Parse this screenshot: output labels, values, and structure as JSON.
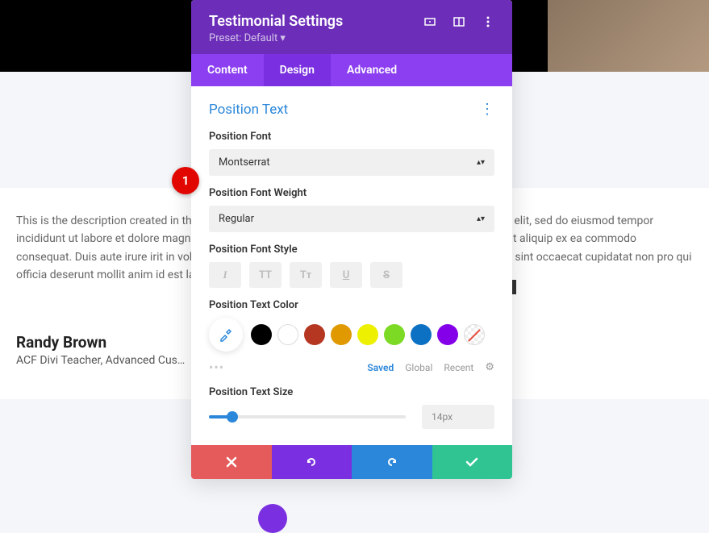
{
  "background": {
    "description": "This is the description created in the ACF form. Lorem ipsum dolor sit amet, consectetur adipiscing elit, sed do eiusmod tempor incididunt ut labore et dolore magna aliqua. Ut enim, quis nostrud exercitation ullamco laboris nisi ut aliquip ex ea commodo consequat. Duis aute irure irit in voluptate velit esse cillum dolore eu fugiat nulla pariatur. Excepteur sint occaecat cupidatat non pro qui officia deserunt mollit anim id est laborum.",
    "author": "Randy Brown",
    "author_title": "ACF Divi Teacher, Advanced Cus…"
  },
  "panel": {
    "title": "Testimonial Settings",
    "preset": "Preset: Default ▾",
    "tabs": {
      "content": "Content",
      "design": "Design",
      "advanced": "Advanced"
    },
    "section": "Position Text",
    "labels": {
      "font": "Position Font",
      "weight": "Position Font Weight",
      "style": "Position Font Style",
      "color": "Position Text Color",
      "size": "Position Text Size"
    },
    "values": {
      "font": "Montserrat",
      "weight": "Regular",
      "size": "14px"
    },
    "style_buttons": {
      "italic": "I",
      "uppercase": "TT",
      "smallcaps": "Tᴛ",
      "underline": "U",
      "strikethrough": "S"
    },
    "colors": {
      "black": "#000000",
      "white": "#ffffff",
      "red": "#b53621",
      "orange": "#e09900",
      "yellow": "#edf000",
      "green": "#7cda24",
      "blue": "#0c71c3",
      "purple": "#8300e9"
    },
    "color_tabs": {
      "saved": "Saved",
      "global": "Global",
      "recent": "Recent"
    }
  },
  "badge": {
    "number": "1"
  }
}
